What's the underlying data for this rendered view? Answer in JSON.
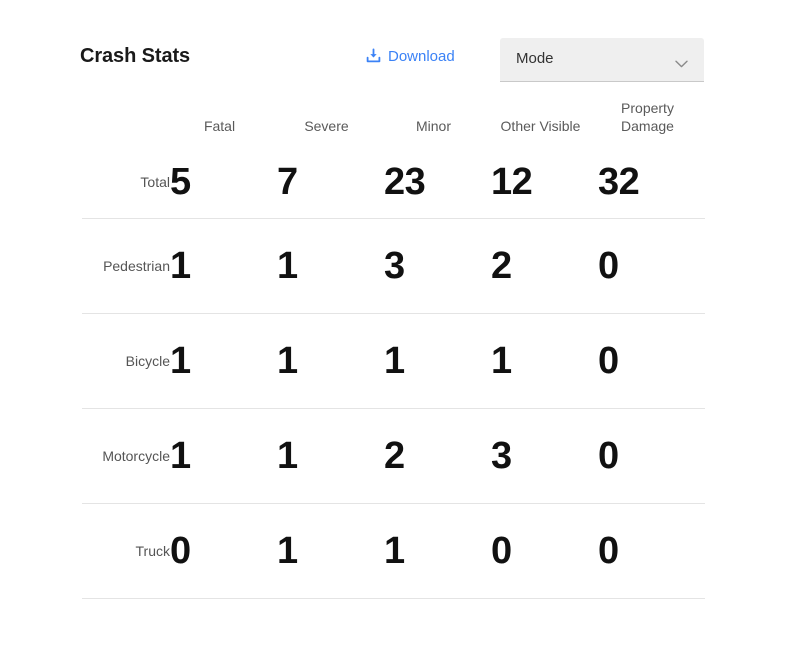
{
  "header": {
    "title": "Crash Stats",
    "download": {
      "label": "Download",
      "icon": "download-icon",
      "color": "#3b82f6"
    },
    "mode_select": {
      "value": "Mode",
      "icon": "chevron-down-icon",
      "background": "#efefef"
    }
  },
  "chart_data": {
    "type": "table",
    "title": "Crash Stats",
    "xlabel": "",
    "ylabel": "",
    "row_header_label": "",
    "categories": [
      "Fatal",
      "Severe",
      "Minor",
      "Other Visible",
      "Property Damage"
    ],
    "rows": [
      {
        "label": "Total",
        "values": [
          5,
          7,
          23,
          12,
          32
        ]
      },
      {
        "label": "Pedestrian",
        "values": [
          1,
          1,
          3,
          2,
          0
        ]
      },
      {
        "label": "Bicycle",
        "values": [
          1,
          1,
          1,
          1,
          0
        ]
      },
      {
        "label": "Motorcycle",
        "values": [
          1,
          1,
          2,
          3,
          0
        ]
      },
      {
        "label": "Truck",
        "values": [
          0,
          1,
          1,
          0,
          0
        ]
      }
    ],
    "series": [
      {
        "name": "Fatal",
        "values": [
          5,
          1,
          1,
          1,
          0
        ]
      },
      {
        "name": "Severe",
        "values": [
          7,
          1,
          1,
          1,
          1
        ]
      },
      {
        "name": "Minor",
        "values": [
          23,
          3,
          1,
          2,
          1
        ]
      },
      {
        "name": "Other Visible",
        "values": [
          12,
          2,
          1,
          3,
          0
        ]
      },
      {
        "name": "Property Damage",
        "values": [
          32,
          0,
          0,
          0,
          0
        ]
      }
    ],
    "grid": false,
    "legend": "none"
  },
  "colors": {
    "accent": "#3b82f6",
    "value_text": "#111111",
    "label_text": "#555555",
    "header_text": "#5a5a5a",
    "divider": "#e4e4e4",
    "background": "#ffffff"
  }
}
